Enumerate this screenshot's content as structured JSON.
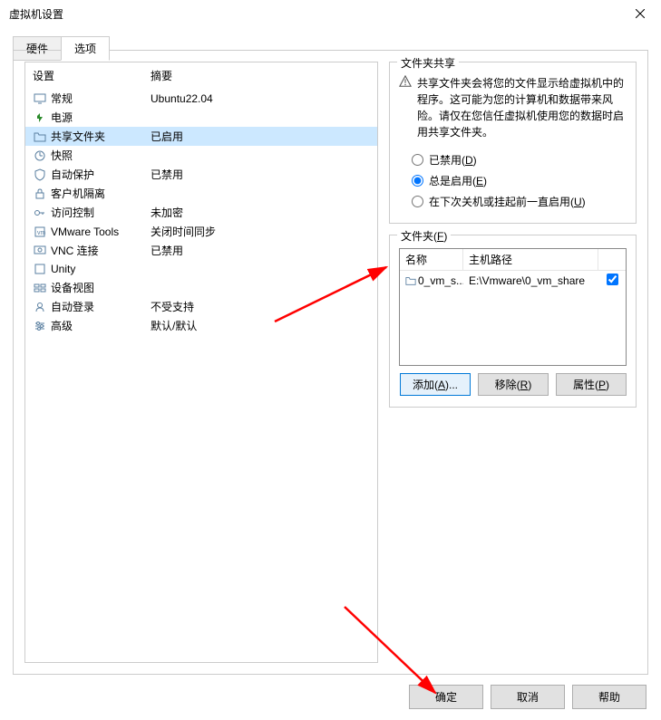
{
  "window": {
    "title": "虚拟机设置"
  },
  "tabs": {
    "hardware": "硬件",
    "options": "选项"
  },
  "settings_header": {
    "setting": "设置",
    "summary": "摘要"
  },
  "settings": [
    {
      "name": "常规",
      "summary": "Ubuntu22.04",
      "icon": "monitor"
    },
    {
      "name": "电源",
      "summary": "",
      "icon": "power"
    },
    {
      "name": "共享文件夹",
      "summary": "已启用",
      "icon": "folder",
      "selected": true
    },
    {
      "name": "快照",
      "summary": "",
      "icon": "snapshot"
    },
    {
      "name": "自动保护",
      "summary": "已禁用",
      "icon": "shield"
    },
    {
      "name": "客户机隔离",
      "summary": "",
      "icon": "lock"
    },
    {
      "name": "访问控制",
      "summary": "未加密",
      "icon": "key"
    },
    {
      "name": "VMware Tools",
      "summary": "关闭时间同步",
      "icon": "vmtools"
    },
    {
      "name": "VNC 连接",
      "summary": "已禁用",
      "icon": "vnc"
    },
    {
      "name": "Unity",
      "summary": "",
      "icon": "unity"
    },
    {
      "name": "设备视图",
      "summary": "",
      "icon": "appliance"
    },
    {
      "name": "自动登录",
      "summary": "不受支持",
      "icon": "autologin"
    },
    {
      "name": "高级",
      "summary": "默认/默认",
      "icon": "advanced"
    }
  ],
  "share": {
    "group_title": "文件夹共享",
    "warning": "共享文件夹会将您的文件显示给虚拟机中的程序。这可能为您的计算机和数据带来风险。请仅在您信任虚拟机使用您的数据时启用共享文件夹。",
    "radios": {
      "disabled": "已禁用(",
      "disabled_u": "D",
      "disabled_end": ")",
      "always": "总是启用(",
      "always_u": "E",
      "always_end": ")",
      "until": "在下次关机或挂起前一直启用(",
      "until_u": "U",
      "until_end": ")"
    }
  },
  "folders": {
    "group_title_pre": "文件夹(",
    "group_title_u": "F",
    "group_title_end": ")",
    "th_name": "名称",
    "th_path": "主机路径",
    "rows": [
      {
        "name": "0_vm_s...",
        "path": "E:\\Vmware\\0_vm_share",
        "checked": true
      }
    ],
    "buttons": {
      "add_pre": "添加(",
      "add_u": "A",
      "add_end": ")...",
      "remove_pre": "移除(",
      "remove_u": "R",
      "remove_end": ")",
      "props_pre": "属性(",
      "props_u": "P",
      "props_end": ")"
    }
  },
  "footer": {
    "ok": "确定",
    "cancel": "取消",
    "help": "帮助"
  }
}
